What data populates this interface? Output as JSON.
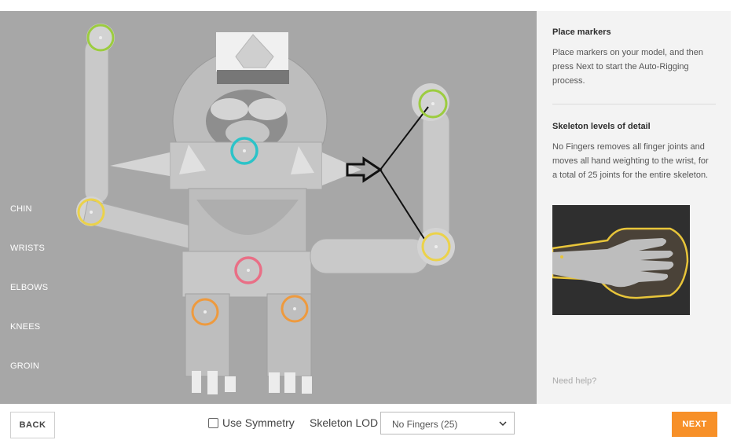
{
  "markers": {
    "items": [
      {
        "label": "CHIN"
      },
      {
        "label": "WRISTS"
      },
      {
        "label": "ELBOWS"
      },
      {
        "label": "KNEES"
      },
      {
        "label": "GROIN"
      }
    ]
  },
  "panel": {
    "place_title": "Place markers",
    "place_text": "Place markers on your model, and then press Next to start the Auto-Rigging process.",
    "lod_title": "Skeleton levels of detail",
    "lod_text": "No Fingers removes all finger joints and moves all hand weighting to the wrist, for a total of 25 joints for the entire skeleton.",
    "help": "Need help?"
  },
  "footer": {
    "back_label": "BACK",
    "symmetry_label": "Use Symmetry",
    "symmetry_checked": false,
    "lod_label": "Skeleton LOD",
    "lod_value": "No Fingers (25)",
    "next_label": "NEXT"
  },
  "colors": {
    "viewport_bg": "#a7a7a7",
    "next_button": "#f79028",
    "chin_marker": "#2cc3c8",
    "wrist_marker": "#9ccc3f",
    "elbow_marker": "#ebd24a",
    "knee_marker": "#ee9a3e",
    "groin_marker": "#e96f86"
  }
}
